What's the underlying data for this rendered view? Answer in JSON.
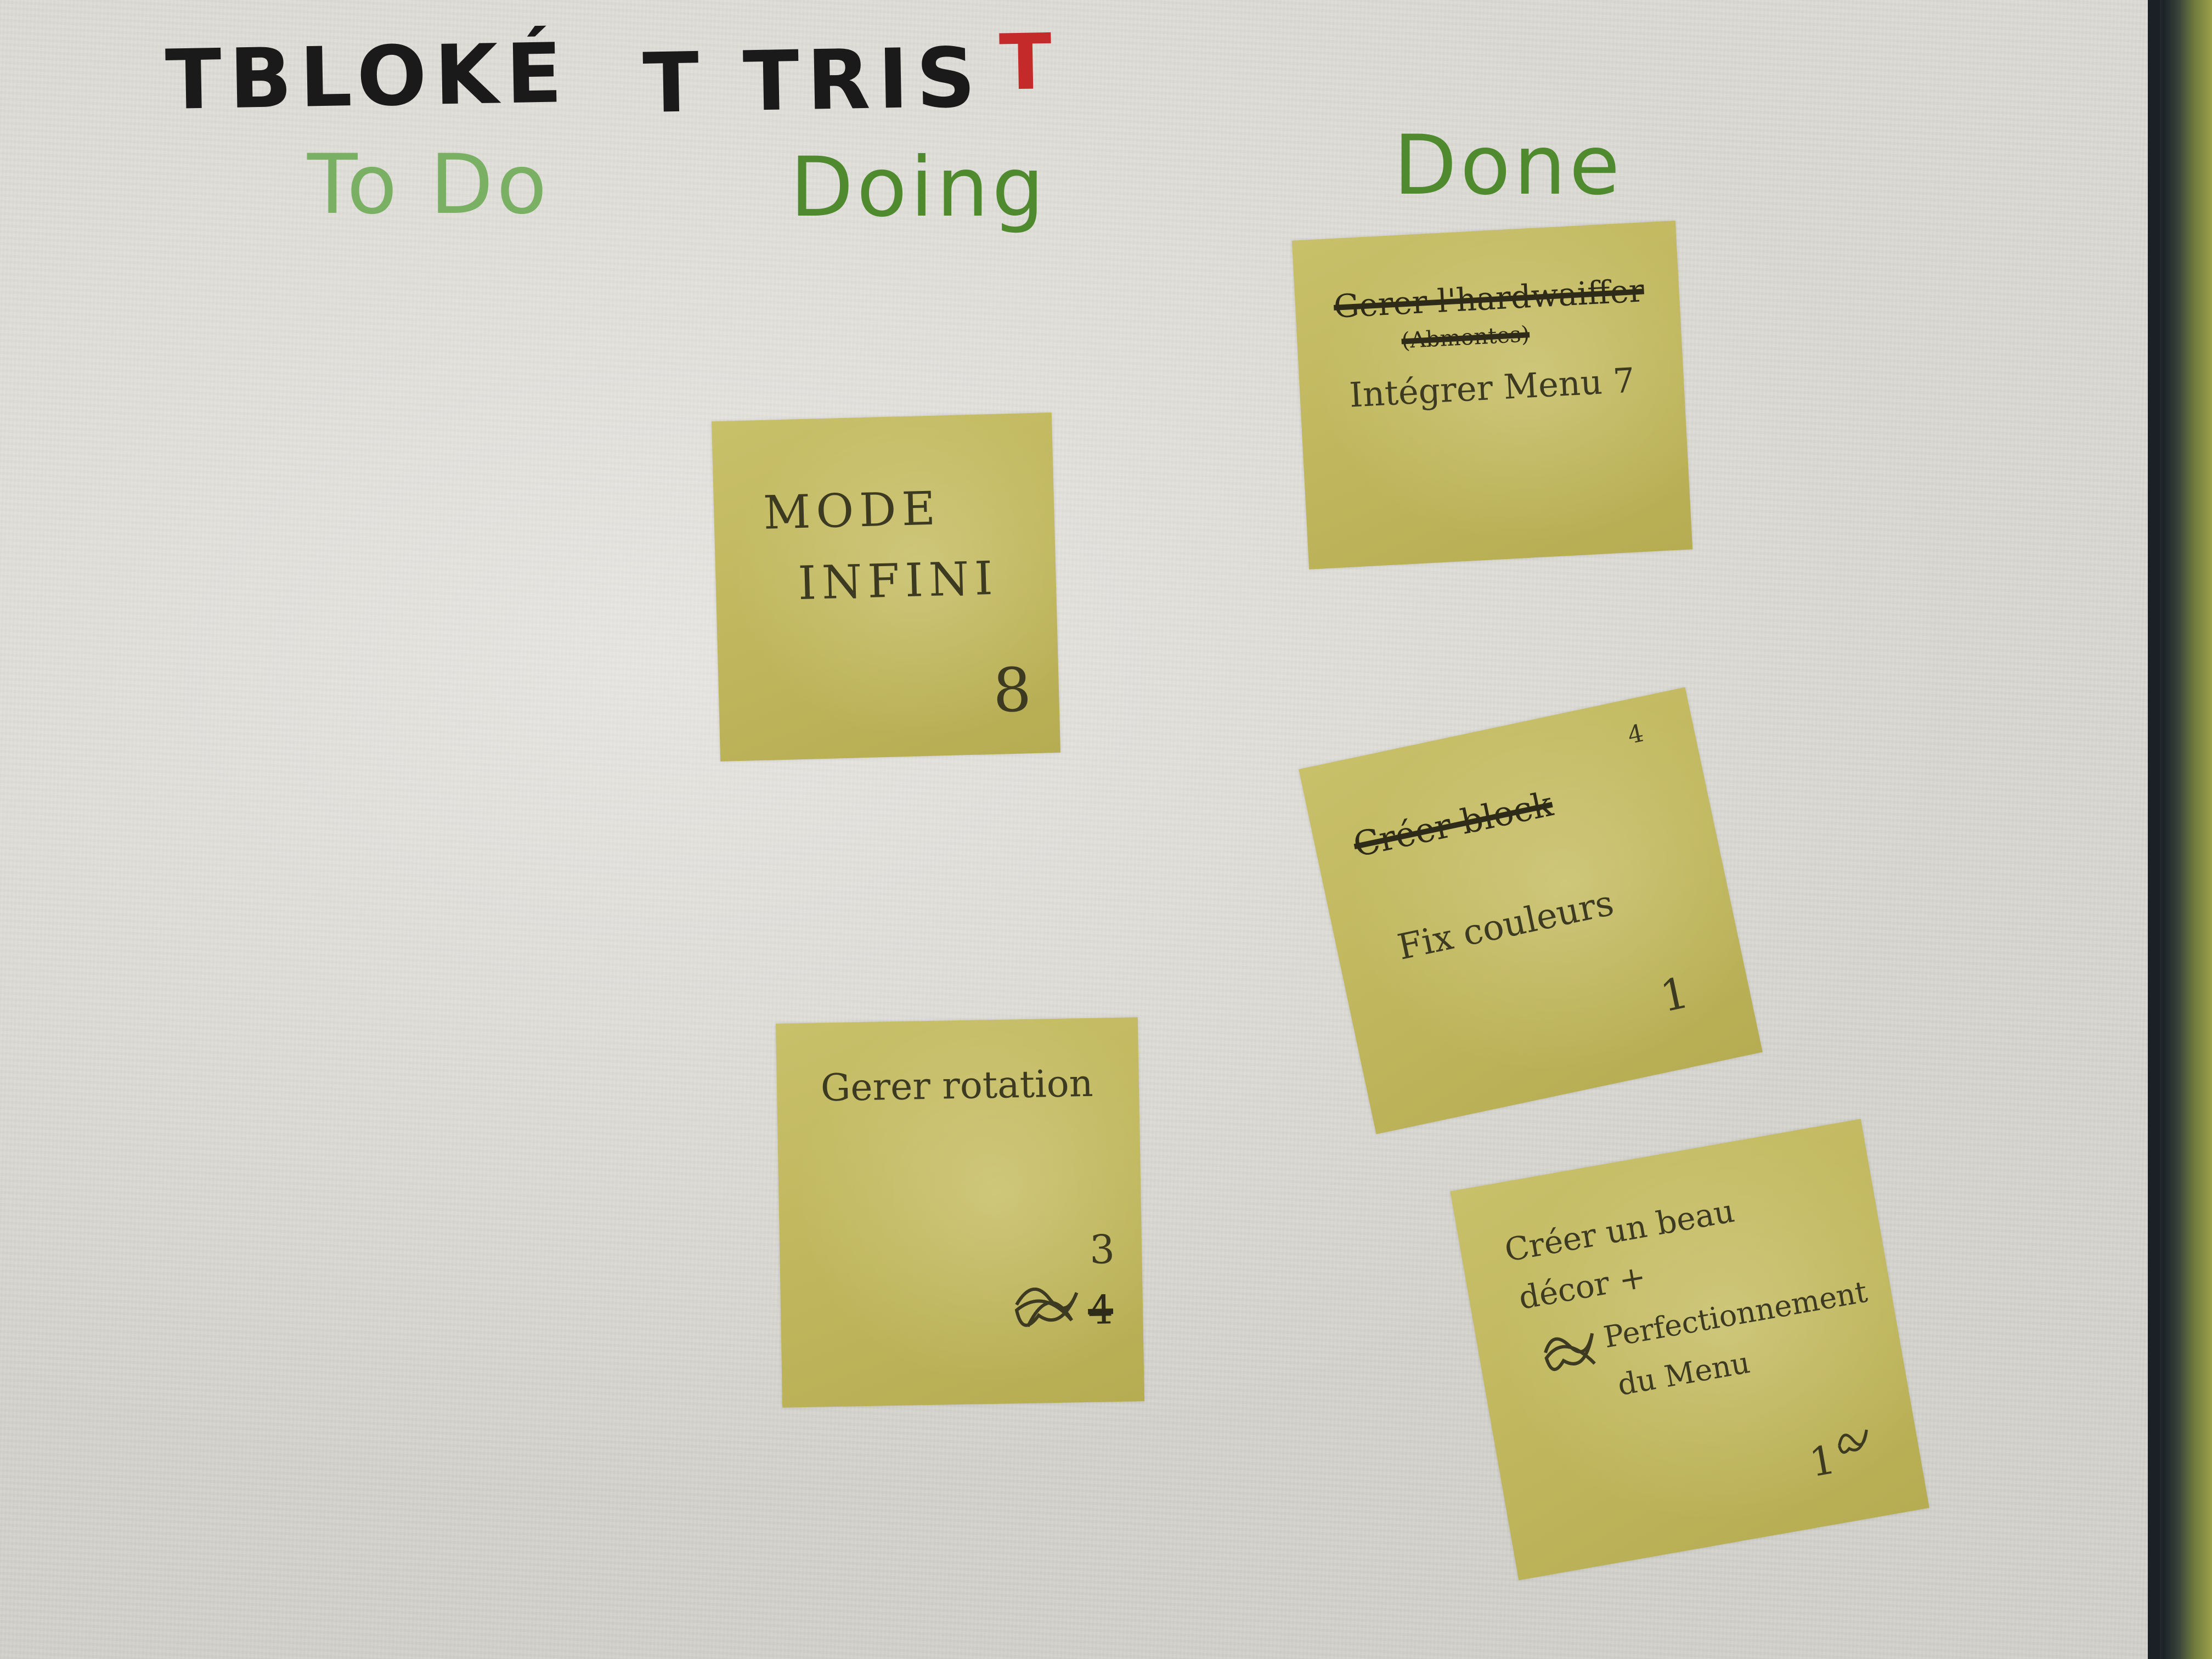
{
  "board": {
    "headers": {
      "blocked": "TBLOKÉ",
      "sorted": "T TRIS",
      "sorted_mark": "T"
    },
    "columns": {
      "todo": "To Do",
      "doing": "Doing",
      "done": "Done"
    }
  },
  "notes": [
    {
      "id": "mode-infini",
      "lines": [
        "MODE",
        "INFINI"
      ],
      "points": "8"
    },
    {
      "id": "gerer-rotation",
      "lines": [
        "Gerer rotation"
      ],
      "points": "3",
      "crossed_points": "4"
    },
    {
      "id": "integrer-menu",
      "crossed_line": "Gerer l'hardwaiffer",
      "crossed_subline": "(Abmontes)",
      "lines": [
        "Intégrer Menu 7"
      ]
    },
    {
      "id": "fix-couleurs",
      "crossed_line": "Créer block",
      "corner_mark": "4",
      "lines": [
        "Fix couleurs"
      ],
      "points": "1"
    },
    {
      "id": "creer-decor",
      "lines": [
        "Créer un beau",
        "décor +",
        "Perfectionnement",
        "du Menu"
      ],
      "points": "1"
    }
  ],
  "colors": {
    "board": "#d9d7d1",
    "note": "#c2b95f",
    "green_marker": "#4f8a2e",
    "black_marker": "#1a1a1a",
    "red_marker": "#c42a2a",
    "pen": "#3d3a22"
  }
}
